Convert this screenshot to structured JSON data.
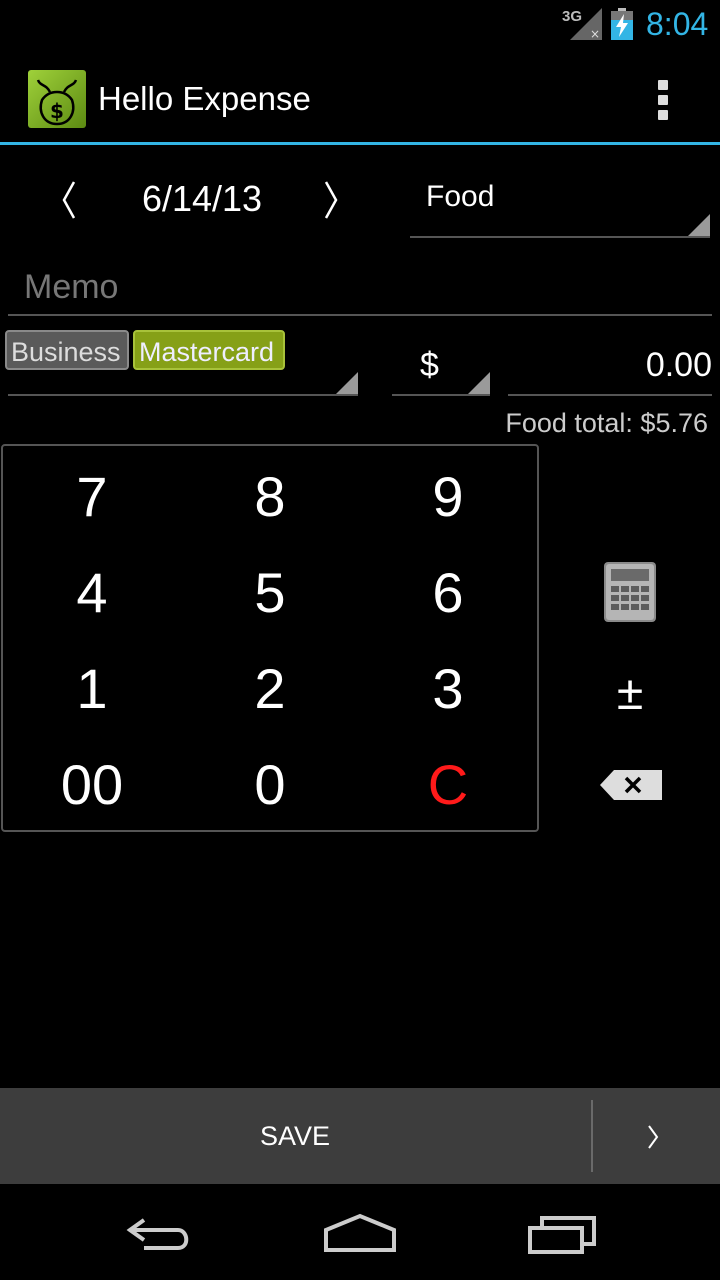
{
  "status_bar": {
    "network": "3G",
    "time": "8:04"
  },
  "action_bar": {
    "title": "Hello Expense",
    "icon": "money-bag-icon"
  },
  "entry": {
    "date": "6/14/13",
    "category": "Food",
    "memo_placeholder": "Memo",
    "tags": [
      "Business",
      "Mastercard"
    ],
    "currency": "$",
    "amount": "0.00",
    "category_total": "Food total: $5.76"
  },
  "keypad": {
    "keys": [
      "7",
      "8",
      "9",
      "4",
      "5",
      "6",
      "1",
      "2",
      "3",
      "00",
      "0",
      "C"
    ]
  },
  "side_buttons": {
    "plus_minus": "±"
  },
  "bottom_bar": {
    "save_label": "SAVE"
  },
  "colors": {
    "accent": "#33b5e5",
    "clear_key": "#ff1a1a",
    "tag_business": "#5a5a5a",
    "tag_mastercard": "#86a017"
  }
}
